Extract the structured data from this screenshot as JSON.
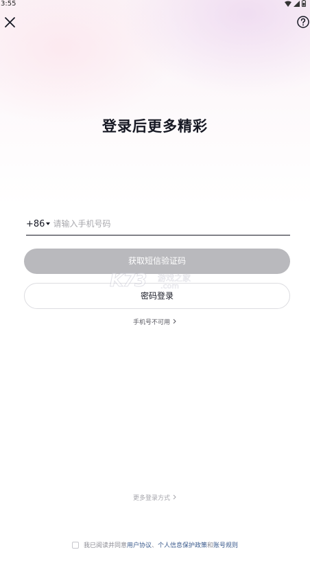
{
  "status_bar": {
    "time": "3:55"
  },
  "header": {
    "close_icon": "close-icon",
    "help_icon": "help-circle-icon"
  },
  "title": "登录后更多精彩",
  "phone": {
    "country_code": "+86",
    "placeholder": "请输入手机号码",
    "value": ""
  },
  "buttons": {
    "get_code": "获取短信验证码",
    "password_login": "密码登录"
  },
  "watermark": {
    "brand": "K73",
    "cn": "游戏之家",
    "domain": ".com"
  },
  "links": {
    "phone_unavailable": "手机号不可用",
    "more_login": "更多登录方式"
  },
  "agreement": {
    "prefix": "我已阅读并同意",
    "user_agreement": "用户协议",
    "sep": "、",
    "privacy_policy": "个人信息保护政策",
    "and": "和",
    "account_rules": "账号规则"
  },
  "colors": {
    "primary_text": "#161823",
    "disabled_button": "#b9b9bd",
    "link": "#3a5a8c"
  }
}
